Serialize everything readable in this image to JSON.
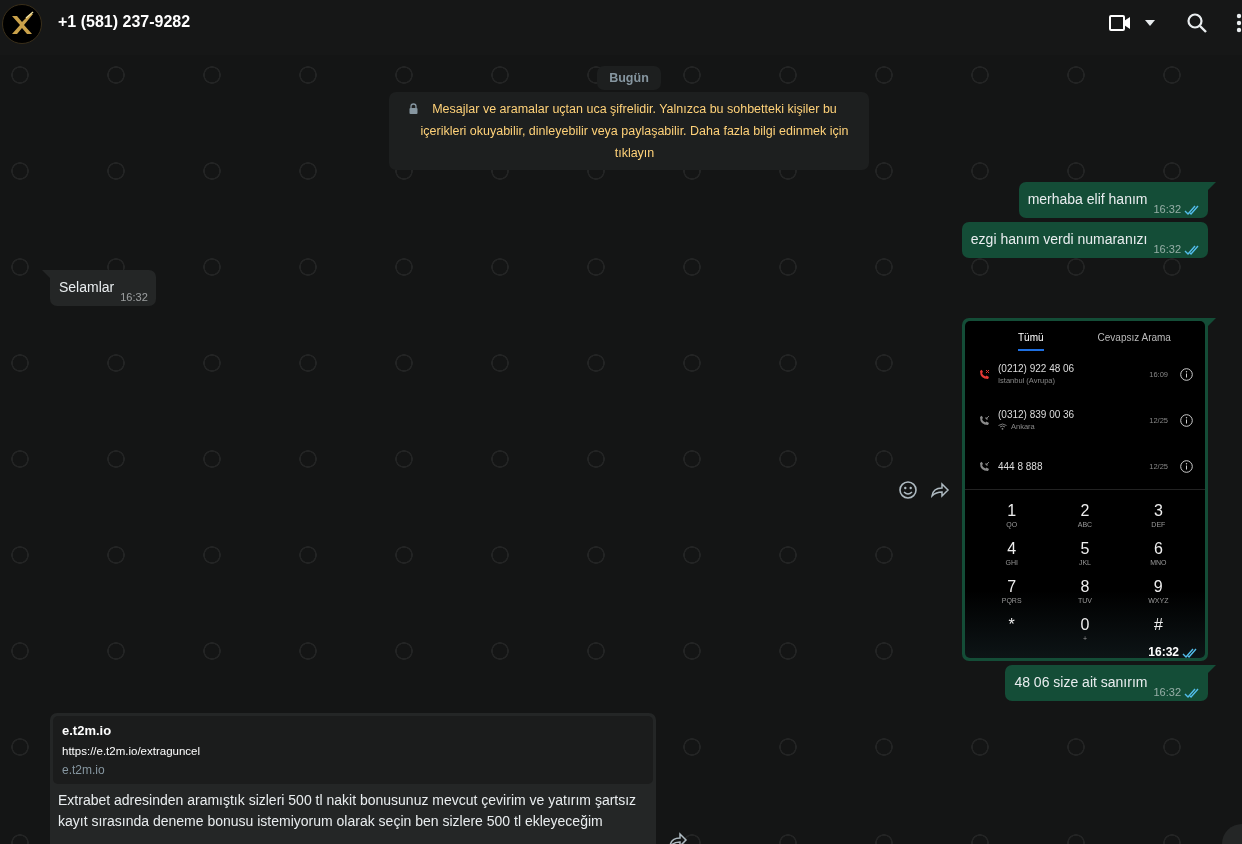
{
  "header": {
    "title": "+1 (581) 237-9282",
    "actions": [
      {
        "kind": "video"
      },
      {
        "kind": "caret"
      },
      {
        "kind": "search"
      },
      {
        "kind": "menu"
      }
    ]
  },
  "messages": [
    {
      "kind": "date",
      "text": "Bugün"
    },
    {
      "kind": "system",
      "text": "Mesajlar ve aramalar uçtan uca şifrelidir. Yalnızca bu sohbetteki kişiler bu içerikleri okuyabilir, dinleyebilir veya paylaşabilir. Daha fazla bilgi edinmek için tıklayın"
    },
    {
      "kind": "text",
      "outgoing": true,
      "tail": true,
      "text": "merhaba elif hanım",
      "time": "16:32",
      "read": true
    },
    {
      "kind": "text",
      "outgoing": true,
      "tail": false,
      "text": "ezgi hanım verdi numaranızı",
      "time": "16:32",
      "read": true
    },
    {
      "kind": "text",
      "outgoing": false,
      "tail": true,
      "text": "Selamlar",
      "time": "16:32"
    },
    {
      "kind": "image",
      "outgoing": true,
      "tail": true,
      "time": "16:32",
      "read": true,
      "screenshot": {
        "tabs": [
          {
            "label": "Tümü",
            "selected": true
          },
          {
            "label": "Cevapsız Arama",
            "selected": false
          }
        ],
        "calls": [
          {
            "number": "(0212) 922 48 06",
            "location": "Istanbul (Avrupa)",
            "time": "16:09",
            "missed": true,
            "wifi": false
          },
          {
            "number": "(0312) 839 00 36",
            "location": "Ankara",
            "time": "12/25",
            "missed": false,
            "wifi": true
          },
          {
            "number": "444 8 888",
            "time": "12/25",
            "missed": false,
            "wifi": false
          }
        ],
        "keys": [
          {
            "digit": "1",
            "letters": "QO"
          },
          {
            "digit": "2",
            "letters": "ABC"
          },
          {
            "digit": "3",
            "letters": "DEF"
          },
          {
            "digit": "4",
            "letters": "GHI"
          },
          {
            "digit": "5",
            "letters": "JKL"
          },
          {
            "digit": "6",
            "letters": "MNO"
          },
          {
            "digit": "7",
            "letters": "PQRS"
          },
          {
            "digit": "8",
            "letters": "TUV"
          },
          {
            "digit": "9",
            "letters": "WXYZ"
          },
          {
            "digit": "*"
          },
          {
            "digit": "0",
            "letters": "+"
          },
          {
            "digit": "#"
          }
        ]
      }
    },
    {
      "kind": "text",
      "outgoing": true,
      "tail": true,
      "text": "48 06 size ait sanırım",
      "time": "16:32",
      "read": true
    },
    {
      "kind": "link",
      "outgoing": false,
      "tail": false,
      "preview": {
        "title": "e.t2m.io",
        "url": "https://e.t2m.io/extraguncel",
        "domain": "e.t2m.io"
      },
      "text": "Extrabet adresinden aramıştık sizleri 500 tl nakit bonusunuz mevcut çevirim ve yatırım şartsız kayıt sırasında deneme bonusu istemiyorum olarak seçin ben sizlere 500 tl ekleyeceğim"
    }
  ]
}
